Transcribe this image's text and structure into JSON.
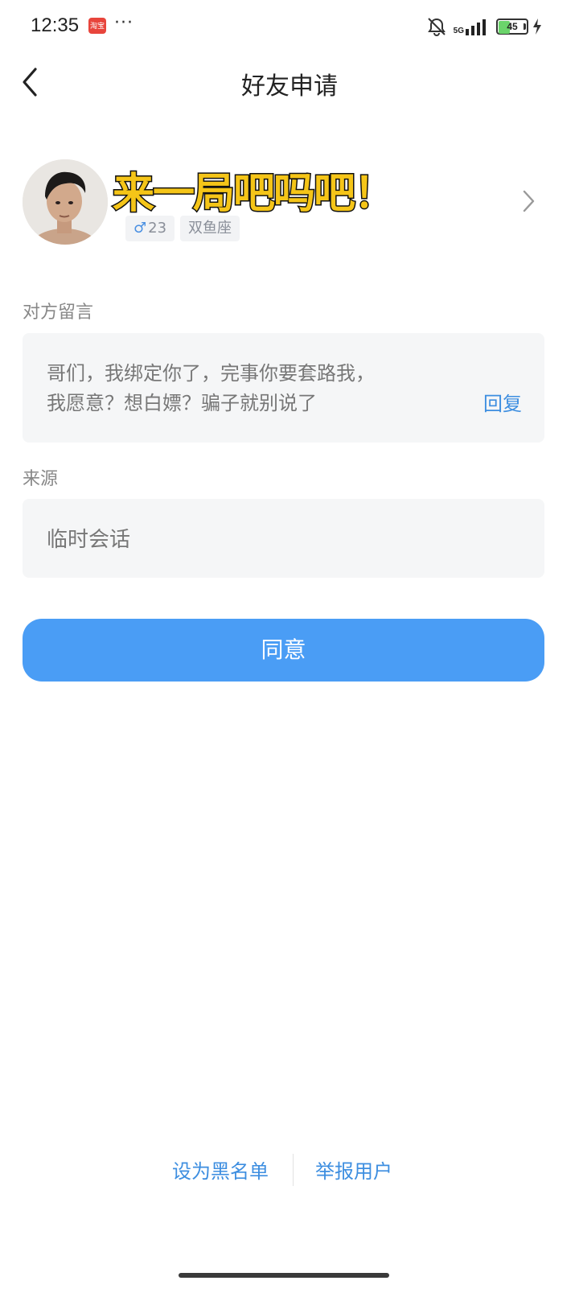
{
  "status_bar": {
    "time": "12:35",
    "app_badge": "淘宝",
    "overflow": "···",
    "network": "5G",
    "battery": "45",
    "battery_level": 0.45
  },
  "nav": {
    "title": "好友申请"
  },
  "profile": {
    "overlay_caption": "来一局吧吗吧！",
    "gender_symbol": "♂",
    "age": "23",
    "zodiac": "双鱼座"
  },
  "message_section": {
    "label": "对方留言",
    "line1": "哥们，我绑定你了，完事你要套路我，",
    "line2": "我愿意？想白嫖？骗子就别说了",
    "reply_label": "回复"
  },
  "source_section": {
    "label": "来源",
    "value": "临时会话"
  },
  "actions": {
    "agree_label": "同意",
    "blacklist_label": "设为黑名单",
    "report_label": "举报用户"
  },
  "colors": {
    "accent": "#4a9df5",
    "link": "#3d8ee0",
    "caption_fill": "#f5c518"
  }
}
